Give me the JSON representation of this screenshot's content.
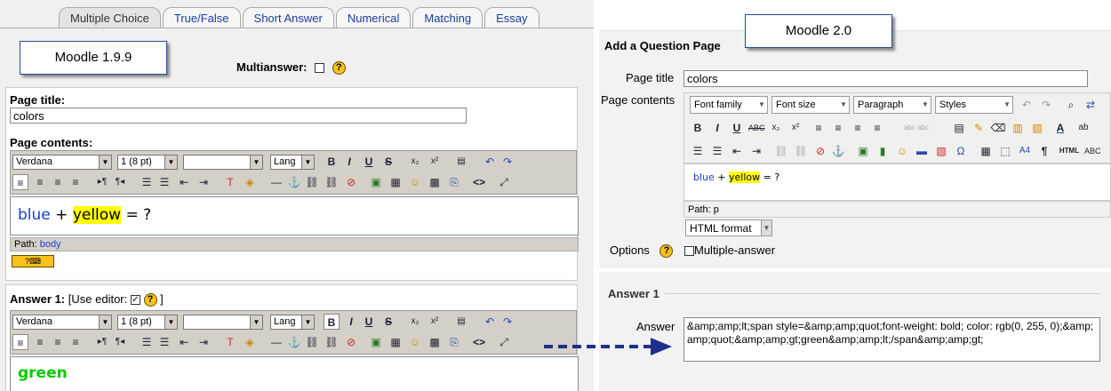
{
  "left": {
    "tabs": [
      "Multiple Choice",
      "True/False",
      "Short Answer",
      "Numerical",
      "Matching",
      "Essay"
    ],
    "callout": "Moodle 1.9.9",
    "multianswer_label": "Multianswer:",
    "page_title_label": "Page title:",
    "page_title_value": "colors",
    "page_contents_label": "Page contents:",
    "font_select": "Verdana",
    "size_select": "1 (8 pt)",
    "format_select": "",
    "lang_select": "Lang",
    "content_blue": "blue",
    "content_plus": " + ",
    "content_yellow": "yellow",
    "content_rest": " = ?",
    "path_label": "Path:",
    "path_value": "body",
    "answer_label": "Answer 1:",
    "use_editor_label": "[Use editor:",
    "use_editor_close": "]",
    "answer_content": "green"
  },
  "right": {
    "callout": "Moodle 2.0",
    "heading": "Add a Question Page",
    "page_title_label": "Page title",
    "page_title_value": "colors",
    "page_contents_label": "Page contents",
    "font_family": "Font family",
    "font_size": "Font size",
    "paragraph": "Paragraph",
    "styles": "Styles",
    "content_blue": "blue",
    "content_plus": " + ",
    "content_yellow": "yellow",
    "content_rest": " = ?",
    "path": "Path: p",
    "format": "HTML format",
    "options_label": "Options",
    "multiple_answer": "Multiple-answer",
    "answer_section": "Answer 1",
    "answer_label": "Answer",
    "answer_value": "&amp;amp;lt;span style=&amp;amp;quot;font-weight: bold; color: rgb(0, 255, 0);&amp;amp;quot;&amp;amp;gt;green&amp;amp;lt;/span&amp;amp;gt;"
  },
  "colors": {
    "link": "#1a3e9a",
    "highlight": "#ffff00",
    "green": "#00cc00",
    "arrow": "#1f2f8a"
  },
  "icons": {
    "bold": "B",
    "italic": "I",
    "underline": "U",
    "strike": "S",
    "subscript": "x₂",
    "superscript": "x²",
    "undo": "↶",
    "redo": "↷",
    "anchor": "⚓",
    "smiley": "☺",
    "source": "<>",
    "omega": "Ω",
    "pilcrow": "¶",
    "help": "?"
  }
}
